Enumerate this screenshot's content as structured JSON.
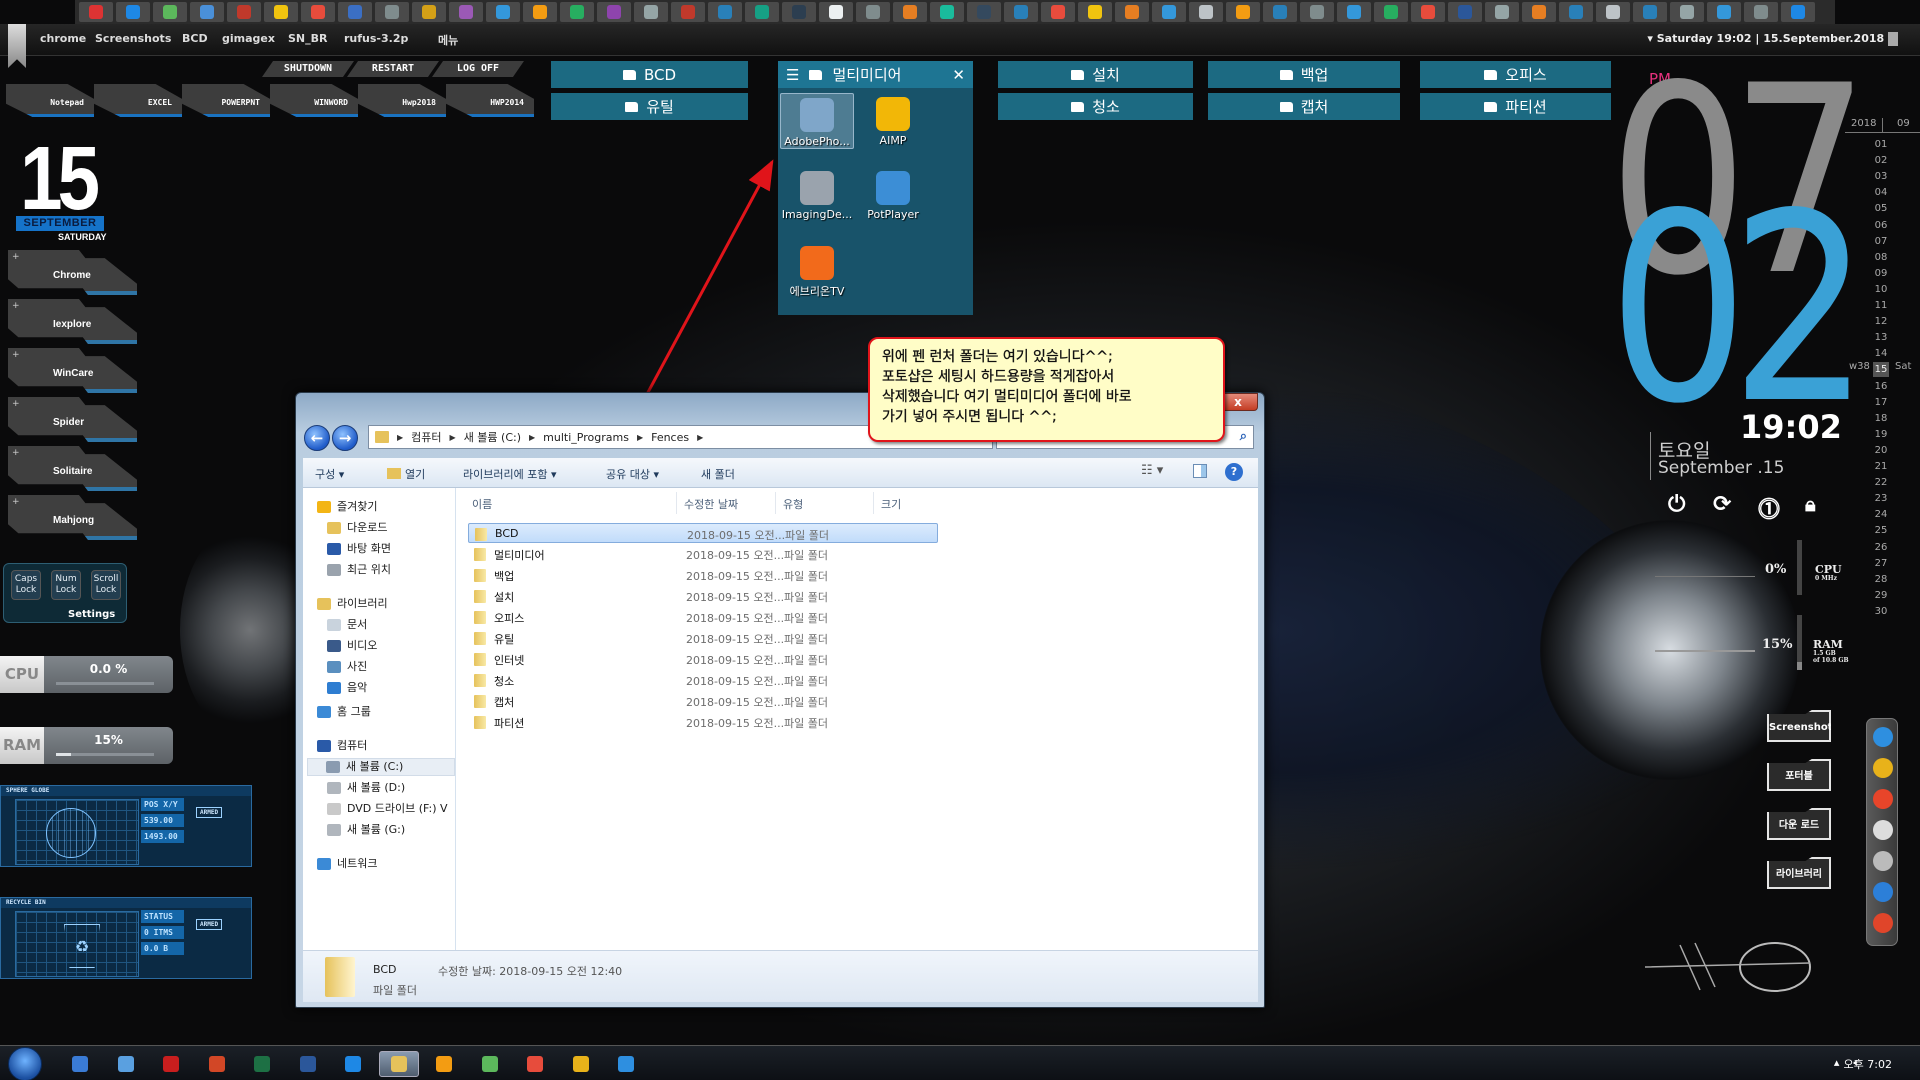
{
  "top_toolbar": {
    "icon_colors": [
      "#d33",
      "#1e88e5",
      "#5cb85c",
      "#4a90d9",
      "#c0392b",
      "#f1c40f",
      "#e74c3c",
      "#3b6fc4",
      "#7f8c8d",
      "#d4a017",
      "#9b59b6",
      "#3498db",
      "#f39c12",
      "#27ae60",
      "#8e44ad",
      "#95a5a6",
      "#c0392b",
      "#2980b9",
      "#16a085",
      "#2c3e50",
      "#ecf0f1",
      "#7f8c8d",
      "#e67e22",
      "#1abc9c",
      "#34495e",
      "#2980b9",
      "#e84c3d",
      "#f1c40f",
      "#e67e22",
      "#3498db",
      "#bdc3c7",
      "#f39c12",
      "#2980b9",
      "#7f8c8d",
      "#3498db",
      "#27ae60",
      "#e74c3c",
      "#2b579a",
      "#95a5a6",
      "#e67e22",
      "#2980b9",
      "#bdc3c7",
      "#2980b9",
      "#95a5a6",
      "#3498db",
      "#7f8c8d",
      "#1e88e5"
    ]
  },
  "topbar": {
    "links": [
      "chrome",
      "Screenshots",
      "BCD",
      "gimagex",
      "SN_BR",
      "rufus-3.2p",
      "메뉴"
    ],
    "datetime": "Saturday 19:02 | 15.September.2018"
  },
  "system_buttons": [
    "SHUTDOWN",
    "RESTART",
    "LOG OFF"
  ],
  "app_tabs": [
    "Notepad",
    "EXCEL",
    "POWERPNT",
    "WINWORD",
    "Hwp2018",
    "HWP2014"
  ],
  "date_widget": {
    "day": "15",
    "month": "SEPTEMBER",
    "weekday": "SATURDAY"
  },
  "launchers": [
    "Chrome",
    "Iexplore",
    "WinCare",
    "Spider",
    "Solitaire",
    "Mahjong"
  ],
  "lock_keys": {
    "caps": "Caps Lock",
    "num": "Num Lock",
    "scroll": "Scroll Lock",
    "settings": "Settings"
  },
  "meters": {
    "cpu": {
      "label": "CPU",
      "value": "0.0 %",
      "percent": 0
    },
    "ram": {
      "label": "RAM",
      "value": "15%",
      "percent": 15
    }
  },
  "hud_widgets": {
    "globe": {
      "title": "SPHERE GLOBE",
      "pos_label": "POS X/Y",
      "x": "539.00",
      "y": "1493.00",
      "status": "ARMED"
    },
    "recycle": {
      "title": "RECYCLE BIN",
      "status_label": "STATUS",
      "items": "0 ITMS",
      "size": "0.0 B",
      "status": "ARMED"
    }
  },
  "fences": {
    "small": [
      "BCD",
      "유틸",
      "설치",
      "청소",
      "백업",
      "캡처",
      "오피스",
      "파티션"
    ],
    "multimedia": {
      "title": "멀티미디어",
      "items": [
        {
          "label": "AdobePho...",
          "color": "#7fa6c9",
          "selected": true
        },
        {
          "label": "AIMP",
          "color": "#f2b707"
        },
        {
          "label": "ImagingDe...",
          "color": "#9aa3ad"
        },
        {
          "label": "PotPlayer",
          "color": "#3c8ed6"
        },
        {
          "label": "에브리온TV",
          "color": "#f26a1b"
        }
      ]
    }
  },
  "callout": {
    "lines": [
      "위에 펜 런처 폴더는 여기 있습니다^^;",
      "포토샵은 세팅시 하드용량을 적게잡아서",
      "삭제했습니다 여기 멀티미디어 폴더에 바로",
      "가기 넣어 주시면 됩니다 ^^;"
    ],
    "border_color": "#e0141a"
  },
  "explorer": {
    "close_label": "x",
    "breadcrumb": [
      "컴퓨터",
      "새 볼륨 (C:)",
      "multi_Programs",
      "Fences"
    ],
    "toolbar": {
      "organize": "구성 ▾",
      "open": "열기",
      "include_library": "라이브러리에 포함 ▾",
      "share": "공유 대상 ▾",
      "new_folder": "새 폴더"
    },
    "nav": [
      {
        "label": "즐겨찾기",
        "level": 0,
        "color": "#f3b515"
      },
      {
        "label": "다운로드",
        "level": 1,
        "color": "#e6c25b"
      },
      {
        "label": "바탕 화면",
        "level": 1,
        "color": "#2a5aa8"
      },
      {
        "label": "최근 위치",
        "level": 1,
        "color": "#9aa3ad"
      },
      {
        "label": "라이브러리",
        "level": 0,
        "color": "#e6c25b"
      },
      {
        "label": "문서",
        "level": 1,
        "color": "#c9d3dd"
      },
      {
        "label": "비디오",
        "level": 1,
        "color": "#3a5a8a"
      },
      {
        "label": "사진",
        "level": 1,
        "color": "#5a8fbf"
      },
      {
        "label": "음악",
        "level": 1,
        "color": "#2e7dd1"
      },
      {
        "label": "홈 그룹",
        "level": 0,
        "color": "#3b8ad6"
      },
      {
        "label": "컴퓨터",
        "level": 0,
        "color": "#2a5aa8"
      },
      {
        "label": "새 볼륨 (C:)",
        "level": 1,
        "color": "#8a9bb0",
        "selected": true
      },
      {
        "label": "새 볼륨 (D:)",
        "level": 1,
        "color": "#b0b6bd"
      },
      {
        "label": "DVD 드라이브 (F:) V",
        "level": 1,
        "color": "#c9c9c9"
      },
      {
        "label": "새 볼륨 (G:)",
        "level": 1,
        "color": "#b0b6bd"
      },
      {
        "label": "네트워크",
        "level": 0,
        "color": "#3b8ad6"
      }
    ],
    "columns": [
      "이름",
      "수정한 날짜",
      "유형",
      "크기"
    ],
    "rows": [
      {
        "name": "BCD",
        "date": "2018-09-15 오전...",
        "type": "파일 폴더",
        "selected": true
      },
      {
        "name": "멀티미디어",
        "date": "2018-09-15 오전...",
        "type": "파일 폴더"
      },
      {
        "name": "백업",
        "date": "2018-09-15 오전...",
        "type": "파일 폴더"
      },
      {
        "name": "설치",
        "date": "2018-09-15 오전...",
        "type": "파일 폴더"
      },
      {
        "name": "오피스",
        "date": "2018-09-15 오전...",
        "type": "파일 폴더"
      },
      {
        "name": "유틸",
        "date": "2018-09-15 오전...",
        "type": "파일 폴더"
      },
      {
        "name": "인터넷",
        "date": "2018-09-15 오전...",
        "type": "파일 폴더"
      },
      {
        "name": "청소",
        "date": "2018-09-15 오전...",
        "type": "파일 폴더"
      },
      {
        "name": "캡처",
        "date": "2018-09-15 오전...",
        "type": "파일 폴더"
      },
      {
        "name": "파티션",
        "date": "2018-09-15 오전...",
        "type": "파일 폴더"
      }
    ],
    "status": {
      "name": "BCD",
      "modified": "수정한 날짜: 2018-09-15 오전 12:40",
      "type": "파일 폴더"
    }
  },
  "clock_widget": {
    "ampm": "PM",
    "hour": "07",
    "minute": "02",
    "time": "19:02",
    "weekday_kr": "토요일",
    "date": "September .15",
    "hour_color": "#8a8a8a",
    "minute_color": "#3aa1d6",
    "ampm_color": "#e7317d"
  },
  "calendar": {
    "year": "2018",
    "month": "09",
    "week": "w38",
    "today": "15",
    "today_weekday": "Sat",
    "days": [
      "01",
      "02",
      "03",
      "04",
      "05",
      "06",
      "07",
      "08",
      "09",
      "10",
      "11",
      "12",
      "13",
      "14",
      "15",
      "16",
      "17",
      "18",
      "19",
      "20",
      "21",
      "22",
      "23",
      "24",
      "25",
      "26",
      "27",
      "28",
      "29",
      "30"
    ]
  },
  "sysmon": {
    "cpu": {
      "percent": "0%",
      "label": "CPU",
      "detail": "0 MHz"
    },
    "ram": {
      "percent": "15%",
      "label": "RAM",
      "detail1": "1.5 GB",
      "detail2": "of 10.8 GB"
    }
  },
  "right_folders": [
    "Screenshots",
    "포터블",
    "다운 로드",
    "라이브러리"
  ],
  "dock_colors": [
    "#2e8fe0",
    "#e8b21a",
    "#e8452a",
    "#dddddd",
    "#bbbbbb",
    "#2c7fd8",
    "#e0452a"
  ],
  "taskbar": {
    "items": [
      {
        "name": "apps",
        "color": "#3a7bd5"
      },
      {
        "name": "app",
        "color": "#5aa0e0"
      },
      {
        "name": "acrobat",
        "color": "#c81e1e"
      },
      {
        "name": "powerpoint",
        "color": "#d24726"
      },
      {
        "name": "excel",
        "color": "#1d7044"
      },
      {
        "name": "word",
        "color": "#2b579a"
      },
      {
        "name": "app2",
        "color": "#1e88e5"
      },
      {
        "name": "explorer",
        "color": "#e6c25b",
        "active": true
      },
      {
        "name": "media",
        "color": "#f39c12"
      },
      {
        "name": "clover",
        "color": "#5cb85c"
      },
      {
        "name": "ccleaner",
        "color": "#e74c3c"
      },
      {
        "name": "chrome",
        "color": "#e8b21a"
      },
      {
        "name": "ie",
        "color": "#2e8fe0"
      }
    ],
    "clock": "오후 7:02"
  }
}
